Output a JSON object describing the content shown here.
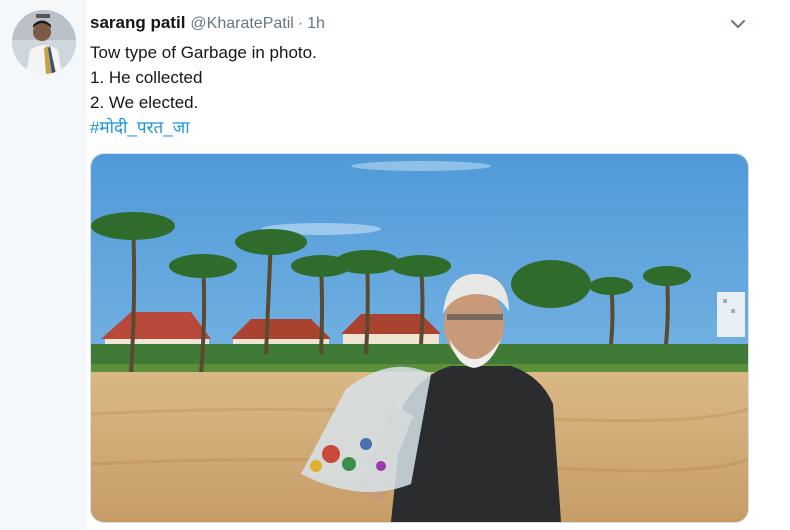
{
  "tweet": {
    "author_name": "sarang patil",
    "author_handle": "@KharatePatil",
    "separator": "·",
    "timestamp": "1h",
    "lines": [
      "Tow type of Garbage in photo.",
      "1. He collected",
      "2. We elected."
    ],
    "hashtag": "#मोदी_परत_जा"
  },
  "icons": {
    "menu": "chevron-down-icon"
  },
  "colors": {
    "link": "#1b95e0",
    "name": "#14171a",
    "meta": "#657786",
    "background": "#e6ecf0"
  }
}
